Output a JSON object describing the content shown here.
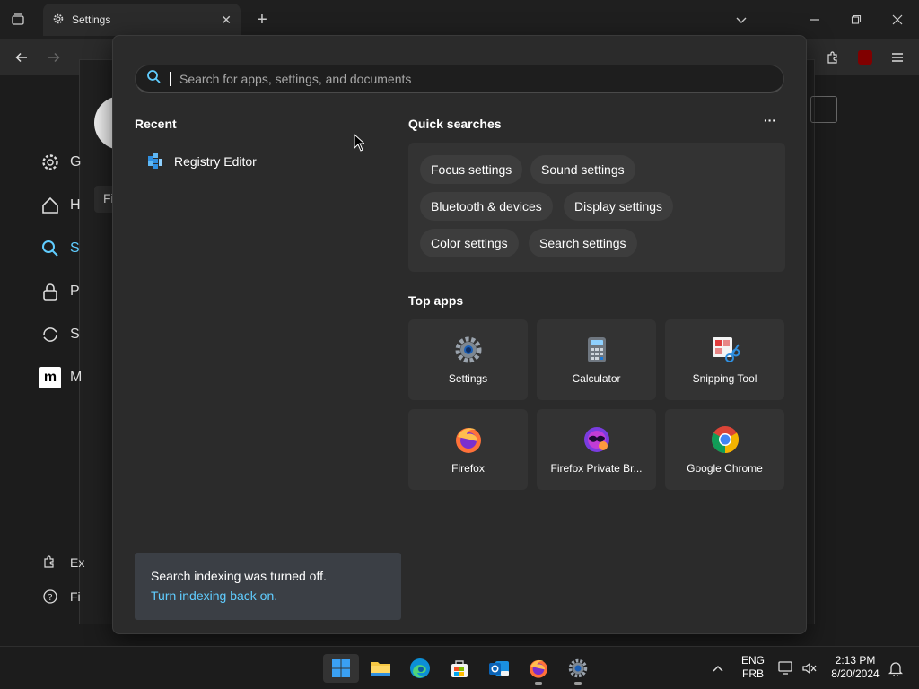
{
  "browser": {
    "tab_title": "Settings"
  },
  "background_settings": {
    "nav_initials": [
      "G",
      "H",
      "S",
      "P",
      "S",
      "M"
    ],
    "bottom_items": [
      "Ex",
      "Fi"
    ],
    "search_initial": "Fi"
  },
  "search": {
    "placeholder": "Search for apps, settings, and documents"
  },
  "recent": {
    "title": "Recent",
    "items": [
      {
        "label": "Registry Editor",
        "icon": "registry-editor-icon"
      }
    ]
  },
  "quick_searches": {
    "title": "Quick searches",
    "more_label": "···",
    "chips": [
      "Focus settings",
      "Sound settings",
      "Bluetooth & devices",
      "Display settings",
      "Color settings",
      "Search settings"
    ]
  },
  "top_apps": {
    "title": "Top apps",
    "apps": [
      {
        "label": "Settings",
        "icon": "settings-gear-icon"
      },
      {
        "label": "Calculator",
        "icon": "calculator-icon"
      },
      {
        "label": "Snipping Tool",
        "icon": "snipping-tool-icon"
      },
      {
        "label": "Firefox",
        "icon": "firefox-icon"
      },
      {
        "label": "Firefox Private Br...",
        "icon": "firefox-private-icon"
      },
      {
        "label": "Google Chrome",
        "icon": "chrome-icon"
      }
    ]
  },
  "index_notice": {
    "message": "Search indexing was turned off.",
    "link": "Turn indexing back on."
  },
  "taskbar": {
    "lang_top": "ENG",
    "lang_bottom": "FRB",
    "time": "2:13 PM",
    "date": "8/20/2024"
  },
  "colors": {
    "accent": "#60cdff",
    "panel": "#2b2b2b",
    "tile": "#333333"
  }
}
